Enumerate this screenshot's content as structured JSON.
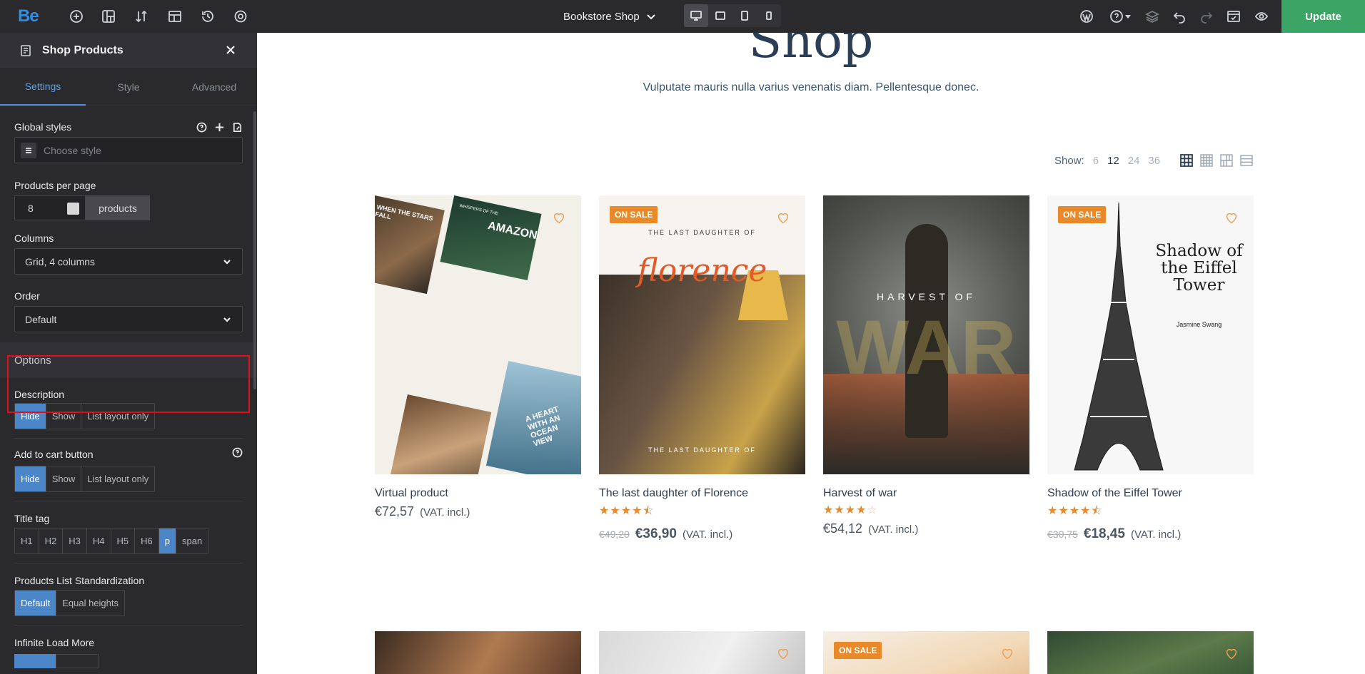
{
  "topbar": {
    "logo": "Be",
    "page_name": "Bookstore Shop",
    "update_label": "Update",
    "icons": [
      "add-icon",
      "structure-icon",
      "sort-icon",
      "layout-icon",
      "history-icon",
      "settings-icon"
    ],
    "right_icons": [
      "wordpress-icon",
      "help-icon",
      "layers-icon",
      "undo-icon",
      "redo-icon",
      "preview-icon",
      "eye-icon"
    ],
    "devices": [
      "desktop",
      "tablet",
      "tablet-portrait",
      "mobile"
    ],
    "active_device": "desktop"
  },
  "sidebar": {
    "title": "Shop Products",
    "tabs": [
      "Settings",
      "Style",
      "Advanced"
    ],
    "active_tab": "Settings",
    "global_styles": {
      "label": "Global styles",
      "placeholder": "Choose style"
    },
    "per_page": {
      "label": "Products per page",
      "value": "8",
      "unit": "products"
    },
    "columns": {
      "label": "Columns",
      "value": "Grid, 4 columns"
    },
    "order": {
      "label": "Order",
      "value": "Default"
    },
    "options_section": "Options",
    "description": {
      "label": "Description",
      "options": [
        "Hide",
        "Show",
        "List layout only"
      ],
      "selected": "Hide"
    },
    "add_to_cart": {
      "label": "Add to cart button",
      "options": [
        "Hide",
        "Show",
        "List layout only"
      ],
      "selected": "Hide"
    },
    "title_tag": {
      "label": "Title tag",
      "options": [
        "H1",
        "H2",
        "H3",
        "H4",
        "H5",
        "H6",
        "p",
        "span"
      ],
      "selected": "p"
    },
    "standardization": {
      "label": "Products List Standardization",
      "options": [
        "Default",
        "Equal heights"
      ],
      "selected": "Default"
    },
    "infinite": {
      "label": "Infinite Load More"
    }
  },
  "main": {
    "title": "Shop",
    "subtitle": "Vulputate mauris nulla varius venenatis diam. Pellentesque donec.",
    "show_label": "Show:",
    "show_options": [
      "6",
      "12",
      "24",
      "36"
    ],
    "show_selected": "12",
    "products": [
      {
        "name": "Virtual product",
        "rating": 0,
        "old_price": "",
        "price": "€72,57",
        "vat": "(VAT. incl.)",
        "sale": "",
        "cover": "virtual"
      },
      {
        "name": "The last daughter of Florence",
        "rating": 4.5,
        "old_price": "€49,20",
        "price": "€36,90",
        "vat": "(VAT. incl.)",
        "sale": "ON SALE",
        "cover": "florence",
        "cover_text": "THE LAST DAUGHTER OF",
        "cover_script": "florence"
      },
      {
        "name": "Harvest of war",
        "rating": 4,
        "old_price": "",
        "price": "€54,12",
        "vat": "(VAT. incl.)",
        "sale": "",
        "cover": "war",
        "cover_text": "HARVEST OF",
        "cover_big": "WAR"
      },
      {
        "name": "Shadow of the Eiffel Tower",
        "rating": 4.5,
        "old_price": "€30,75",
        "price": "€18,45",
        "vat": "(VAT. incl.)",
        "sale": "ON SALE",
        "cover": "eiffel",
        "cover_text": "Shadow of the Eiffel Tower",
        "cover_author": "Jasmine Swang"
      }
    ],
    "second_row_sale": "ON SALE",
    "virtual_cover_texts": [
      "WHEN THE STARS FALL",
      "WHISPERS OF THE",
      "AMAZON",
      "A HEART WITH AN OCEAN VIEW"
    ]
  },
  "colors": {
    "accent": "#4a86c8",
    "update": "#3aa564",
    "sale": "#e88a2a",
    "highlight": "#e0101a"
  }
}
